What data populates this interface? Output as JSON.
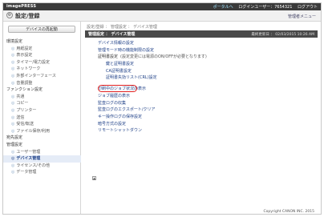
{
  "header": {
    "brand": "imagePRESS",
    "links": [
      "ポータルへ",
      "ログインユーザー：7654321",
      "ログアウト"
    ]
  },
  "titlebar": {
    "icon": "gear-icon",
    "title": "設定/登録",
    "right_link": "管理者メニュー"
  },
  "sidebar": {
    "button_label": "デバイスの再起動",
    "sections": [
      {
        "label": "環境設定",
        "items": [
          "用紙設定",
          "表示設定",
          "タイマー/電力設定",
          "ネットワーク",
          "外部インターフェース",
          "音量調整"
        ]
      },
      {
        "label": "ファンクション設定",
        "items": [
          "共通",
          "コピー",
          "プリンター",
          "送信",
          "受信/転送",
          "ファイル保存/利用"
        ]
      },
      {
        "label": "宛先設定",
        "items": []
      },
      {
        "label": "管理設定",
        "items": [
          "ユーザー管理",
          "デバイス管理",
          "ライセンス/その他",
          "データ管理"
        ]
      }
    ],
    "selected": "デバイス管理"
  },
  "main": {
    "breadcrumb": "設定/登録 ： 管理設定 ： デバイス管理",
    "panel_title": "管理設定 ： デバイス管理",
    "timestamp": "最終更新日 ： 02/03/2015 10:26 AM",
    "items": [
      {
        "label": "デバイス情報の設定",
        "sub": false
      },
      {
        "label": "管理モード時の機能制限の設定",
        "sub": false
      },
      {
        "label": "証明書設定",
        "note": "(設定変更には電源のON/OFFが必要となります)",
        "sub": false,
        "plain": true
      },
      {
        "label": "鍵と証明書設定",
        "sub": true
      },
      {
        "label": "CA証明書設定",
        "sub": true
      },
      {
        "label": "証明書失効リスト(CRL)設定",
        "sub": true
      },
      {
        "label": "印刷中のジョブ状況の表示",
        "sub": false,
        "gap": true
      },
      {
        "label": "ジョブ履歴の表示",
        "sub": false
      },
      {
        "label": "監査ログの収集",
        "sub": false
      },
      {
        "label": "監査ログのエクスポート/クリア",
        "sub": false
      },
      {
        "label": "キー操作ログの保存設定",
        "sub": false
      },
      {
        "label": "暗号方式の設定",
        "sub": false
      },
      {
        "label": "リモートシャットダウン",
        "sub": false
      }
    ],
    "copyright": "Copyright CANON INC. 2015"
  },
  "colors": {
    "highlight": "#e02020",
    "link": "#1d3f86",
    "topbar": "#3b3b3b"
  }
}
